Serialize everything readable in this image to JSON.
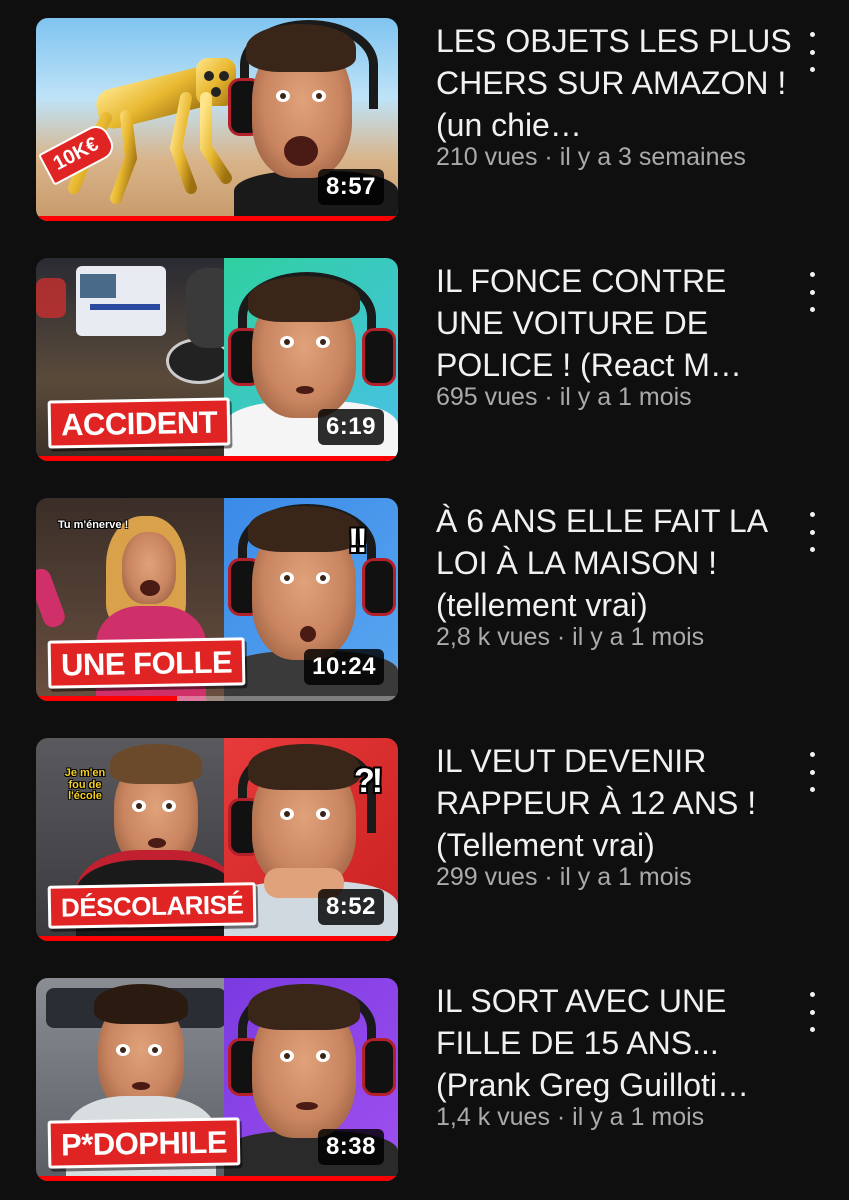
{
  "colors": {
    "background": "#0f0f0f",
    "title_text": "#f1f1f1",
    "meta_text": "#aaaaaa",
    "progress": "#ff0000",
    "tag_red": "#e02424"
  },
  "videos": [
    {
      "title": "LES OBJETS LES PLUS CHERS SUR AMAZON ! (un chie…",
      "views": "210 vues",
      "age": "il y a 3 semaines",
      "duration": "8:57",
      "watched_fraction": 1.0,
      "thumbnail_tag": "10K€",
      "thumbnail_icon": "golden-robot-dog"
    },
    {
      "title": "IL FONCE CONTRE UNE VOITURE DE POLICE ! (React M…",
      "views": "695 vues",
      "age": "il y a 1 mois",
      "duration": "6:19",
      "watched_fraction": 1.0,
      "thumbnail_tag": "ACCIDENT",
      "thumbnail_icon": "police-van-street"
    },
    {
      "title": "À 6 ANS ELLE FAIT LA LOI À LA MAISON ! (tellement vrai)",
      "views": "2,8 k vues",
      "age": "il y a 1 mois",
      "duration": "10:24",
      "watched_fraction": 0.39,
      "thumbnail_tag": "UNE FOLLE",
      "thumbnail_caption": "Tu m'énerve !",
      "thumbnail_punct": "!!",
      "thumbnail_icon": "angry-girl"
    },
    {
      "title": "IL VEUT DEVENIR RAPPEUR À 12 ANS ! (Tellement vrai)",
      "views": "299 vues",
      "age": "il y a 1 mois",
      "duration": "8:52",
      "watched_fraction": 1.0,
      "thumbnail_tag": "DÉSCOLARISÉ",
      "thumbnail_caption": "Je m'en fou de l'école",
      "thumbnail_punct": "?!",
      "thumbnail_icon": "young-boy"
    },
    {
      "title": "IL SORT AVEC UNE FILLE DE 15 ANS... (Prank Greg Guilloti…",
      "views": "1,4 k vues",
      "age": "il y a 1 mois",
      "duration": "8:38",
      "watched_fraction": 1.0,
      "thumbnail_tag": "P*DOPHILE",
      "thumbnail_icon": "man-in-car"
    }
  ],
  "meta_separator": " · ",
  "menu_icon": "more-vertical-icon"
}
